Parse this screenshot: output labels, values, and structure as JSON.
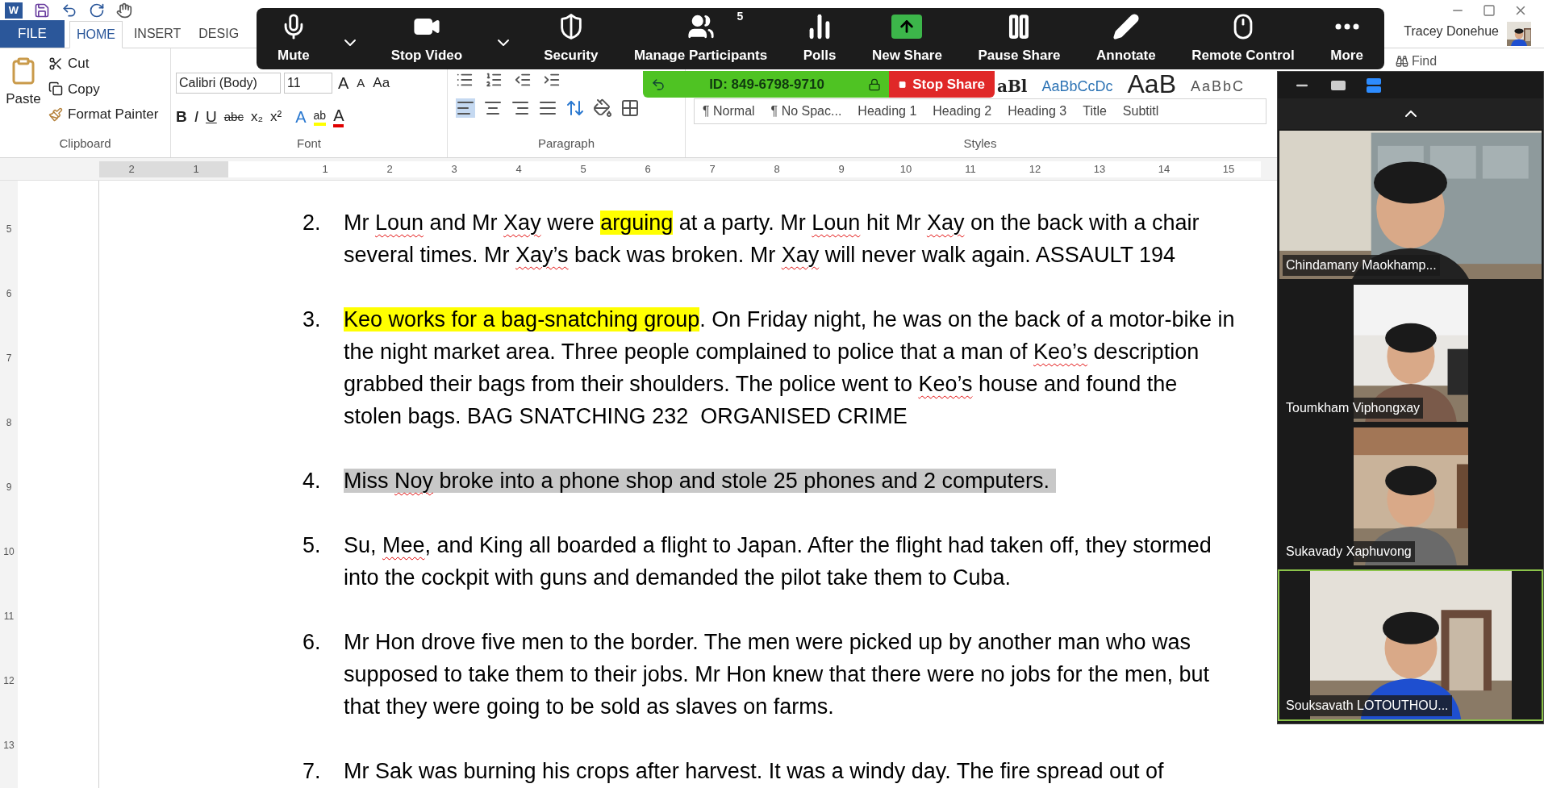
{
  "word": {
    "app_icon": "W",
    "tabs": [
      {
        "label": "FILE",
        "kind": "file",
        "selected": false
      },
      {
        "label": "HOME",
        "kind": "tab",
        "selected": true
      },
      {
        "label": "INSERT",
        "kind": "tab",
        "selected": false
      },
      {
        "label": "DESIG",
        "kind": "tab",
        "selected": false
      }
    ],
    "user": "Tracey Donehue",
    "clipboard": {
      "paste": "Paste",
      "items": [
        "Cut",
        "Copy",
        "Format Painter"
      ],
      "label": "Clipboard"
    },
    "font": {
      "name": "Calibri (Body)",
      "size": "11",
      "grow": "A",
      "shrink": "A",
      "case": "Aa",
      "format_buttons": [
        "B",
        "I",
        "U",
        "abc",
        "x₂",
        "x²"
      ],
      "effects": "A",
      "highlighter": "ab",
      "font_color_letter": "A",
      "label": "Font"
    },
    "paragraph": {
      "label": "Paragraph"
    },
    "styles": {
      "previews": [
        "aBl",
        "AaBbCcDc",
        "AaB",
        "AaBbC"
      ],
      "items": [
        "¶ Normal",
        "¶ No Spac...",
        "Heading 1",
        "Heading 2",
        "Heading 3",
        "Title",
        "Subtitl"
      ],
      "label": "Styles"
    },
    "find": "Find",
    "ruler": [
      "2",
      "1",
      "1",
      "2",
      "3",
      "4",
      "5",
      "6",
      "7",
      "8",
      "9",
      "10",
      "11",
      "12",
      "13",
      "14",
      "15"
    ],
    "vertical_ruler": [
      "5",
      "6",
      "7",
      "8",
      "9",
      "10",
      "11",
      "12",
      "13"
    ]
  },
  "document": {
    "items": [
      {
        "number": "2.",
        "lines": [
          [
            {
              "t": "Mr ",
              "kind": "plain"
            },
            {
              "t": "Loun",
              "kind": "misspelled"
            },
            {
              "t": " and Mr ",
              "kind": "plain"
            },
            {
              "t": "Xay",
              "kind": "misspelled"
            },
            {
              "t": " were ",
              "kind": "plain"
            },
            {
              "t": "arguing",
              "kind": "highlight"
            },
            {
              "t": " at a party. Mr ",
              "kind": "plain"
            },
            {
              "t": "Loun",
              "kind": "misspelled"
            },
            {
              "t": " hit Mr ",
              "kind": "plain"
            },
            {
              "t": "Xay",
              "kind": "misspelled"
            },
            {
              "t": " on the back with a chair",
              "kind": "plain"
            }
          ],
          [
            {
              "t": "several times. Mr ",
              "kind": "plain"
            },
            {
              "t": "Xay’s",
              "kind": "misspelled"
            },
            {
              "t": " back was broken. Mr ",
              "kind": "plain"
            },
            {
              "t": "Xay",
              "kind": "misspelled"
            },
            {
              "t": " will never walk again. ASSAULT 194",
              "kind": "plain"
            }
          ]
        ]
      },
      {
        "number": "3.",
        "lines": [
          [
            {
              "t": "Keo works for a bag-snatching group",
              "kind": "highlight"
            },
            {
              "t": ". On Friday night, he was on the back of a motor-bike in",
              "kind": "plain"
            }
          ],
          [
            {
              "t": "the night market area. Three people complained to police that a man of ",
              "kind": "plain"
            },
            {
              "t": "Keo’s",
              "kind": "misspelled"
            },
            {
              "t": " description",
              "kind": "plain"
            }
          ],
          [
            {
              "t": "grabbed their bags from their shoulders. The police went to ",
              "kind": "plain"
            },
            {
              "t": "Keo’s",
              "kind": "misspelled"
            },
            {
              "t": " house and found the",
              "kind": "plain"
            }
          ],
          [
            {
              "t": "stolen bags. BAG SNATCHING 232  ORGANISED CRIME",
              "kind": "plain"
            }
          ]
        ]
      },
      {
        "number": "4.",
        "lines": [
          [
            {
              "t": "Miss ",
              "kind": "selected"
            },
            {
              "t": "Noy",
              "kind": "selected-misspelled"
            },
            {
              "t": " broke into a phone shop and stole 25 phones and 2 computers. ",
              "kind": "selected"
            }
          ]
        ]
      },
      {
        "number": "5.",
        "lines": [
          [
            {
              "t": "Su, ",
              "kind": "plain"
            },
            {
              "t": "Mee",
              "kind": "misspelled"
            },
            {
              "t": ", and King all boarded a flight to Japan. After the flight had taken off, they stormed",
              "kind": "plain"
            }
          ],
          [
            {
              "t": "into the cockpit with guns and demanded the pilot take them to Cuba.",
              "kind": "plain"
            }
          ]
        ]
      },
      {
        "number": "6.",
        "lines": [
          [
            {
              "t": "Mr Hon drove five men to the border. The men were picked up by another man who was",
              "kind": "plain"
            }
          ],
          [
            {
              "t": "supposed to take them to their jobs. Mr Hon knew that there were no jobs for the men, but",
              "kind": "plain"
            }
          ],
          [
            {
              "t": "that they were going to be sold as slaves on farms.",
              "kind": "plain"
            }
          ]
        ]
      },
      {
        "number": "7.",
        "lines": [
          [
            {
              "t": "Mr Sak was burning his crops after harvest. It was a windy day. The fire spread out of",
              "kind": "plain"
            }
          ]
        ]
      }
    ]
  },
  "zoom_toolbar": {
    "items": [
      {
        "kind": "button",
        "label": "Mute"
      },
      {
        "kind": "caret"
      },
      {
        "kind": "button",
        "label": "Stop Video"
      },
      {
        "kind": "caret"
      },
      {
        "kind": "button",
        "label": "Security"
      },
      {
        "kind": "button",
        "label": "Manage Participants",
        "badge": "5"
      },
      {
        "kind": "button",
        "label": "Polls"
      },
      {
        "kind": "share",
        "label": "New Share"
      },
      {
        "kind": "button",
        "label": "Pause Share"
      },
      {
        "kind": "button",
        "label": "Annotate"
      },
      {
        "kind": "button",
        "label": "Remote Control"
      },
      {
        "kind": "button",
        "label": "More"
      }
    ],
    "meeting_id": "ID: 849-6798-9710",
    "stop_share": "Stop Share"
  },
  "participants": [
    {
      "name": "Chindamany Maokhamp...",
      "speaking": false,
      "kind": "wide"
    },
    {
      "name": "Toumkham Viphongxay",
      "speaking": false,
      "kind": "narrow"
    },
    {
      "name": "Sukavady Xaphuvong",
      "speaking": false,
      "kind": "narrow"
    },
    {
      "name": "Souksavath LOTOUTHOU...",
      "speaking": true,
      "kind": "medium"
    }
  ]
}
